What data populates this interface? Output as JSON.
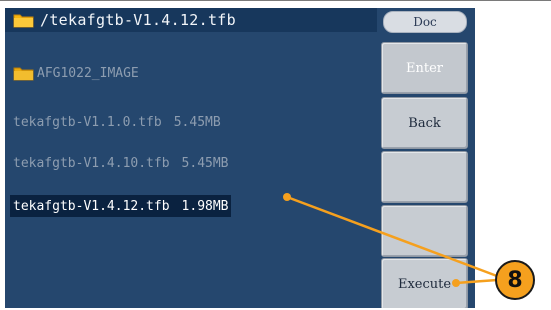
{
  "title_bar": {
    "path": "/tekafgtb-V1.4.12.tfb",
    "icon": "folder-icon"
  },
  "file_list": [
    {
      "name": "AFG1022_IMAGE",
      "size": "",
      "type": "folder",
      "selected": false
    },
    {
      "name": "tekafgtb-V1.1.0.tfb",
      "size": "5.45MB",
      "type": "file",
      "selected": false
    },
    {
      "name": "tekafgtb-V1.4.10.tfb",
      "size": "5.45MB",
      "type": "file",
      "selected": false
    },
    {
      "name": "tekafgtb-V1.4.12.tfb",
      "size": "1.98MB",
      "type": "file",
      "selected": true
    }
  ],
  "side_menu": {
    "tab": "Doc",
    "buttons": [
      {
        "label": "Enter",
        "enabled": false
      },
      {
        "label": "Back",
        "enabled": true
      },
      {
        "label": "",
        "enabled": false
      },
      {
        "label": "",
        "enabled": false
      },
      {
        "label": "Execute",
        "enabled": true
      }
    ]
  },
  "callout": {
    "number": "8",
    "color": "#f5a01e"
  }
}
